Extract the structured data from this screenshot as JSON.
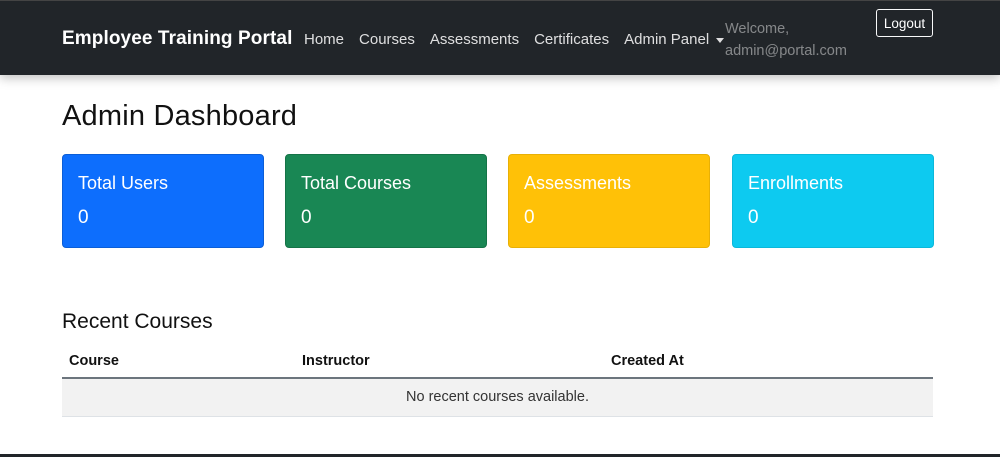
{
  "navbar": {
    "brand": "Employee Training Portal",
    "links": {
      "home": "Home",
      "courses": "Courses",
      "assessments": "Assessments",
      "certificates": "Certificates",
      "admin_panel": "Admin Panel"
    },
    "welcome_line1": "Welcome,",
    "welcome_line2": "admin@portal.com",
    "logout_label": "Logout"
  },
  "main": {
    "title": "Admin Dashboard",
    "cards": [
      {
        "title": "Total Users",
        "value": "0",
        "color": "#0d6efd"
      },
      {
        "title": "Total Courses",
        "value": "0",
        "color": "#198754"
      },
      {
        "title": "Assessments",
        "value": "0",
        "color": "#ffc107"
      },
      {
        "title": "Enrollments",
        "value": "0",
        "color": "#0dcaf0"
      }
    ],
    "recent_courses": {
      "title": "Recent Courses",
      "columns": [
        "Course",
        "Instructor",
        "Created At"
      ],
      "empty_message": "No recent courses available."
    }
  },
  "colors": {
    "navbar_bg": "#212529",
    "accent_blue": "#0d6efd",
    "accent_green": "#198754",
    "accent_yellow": "#ffc107",
    "accent_cyan": "#0dcaf0"
  },
  "icons": {
    "admin_panel_caret": "caret-down-icon"
  }
}
